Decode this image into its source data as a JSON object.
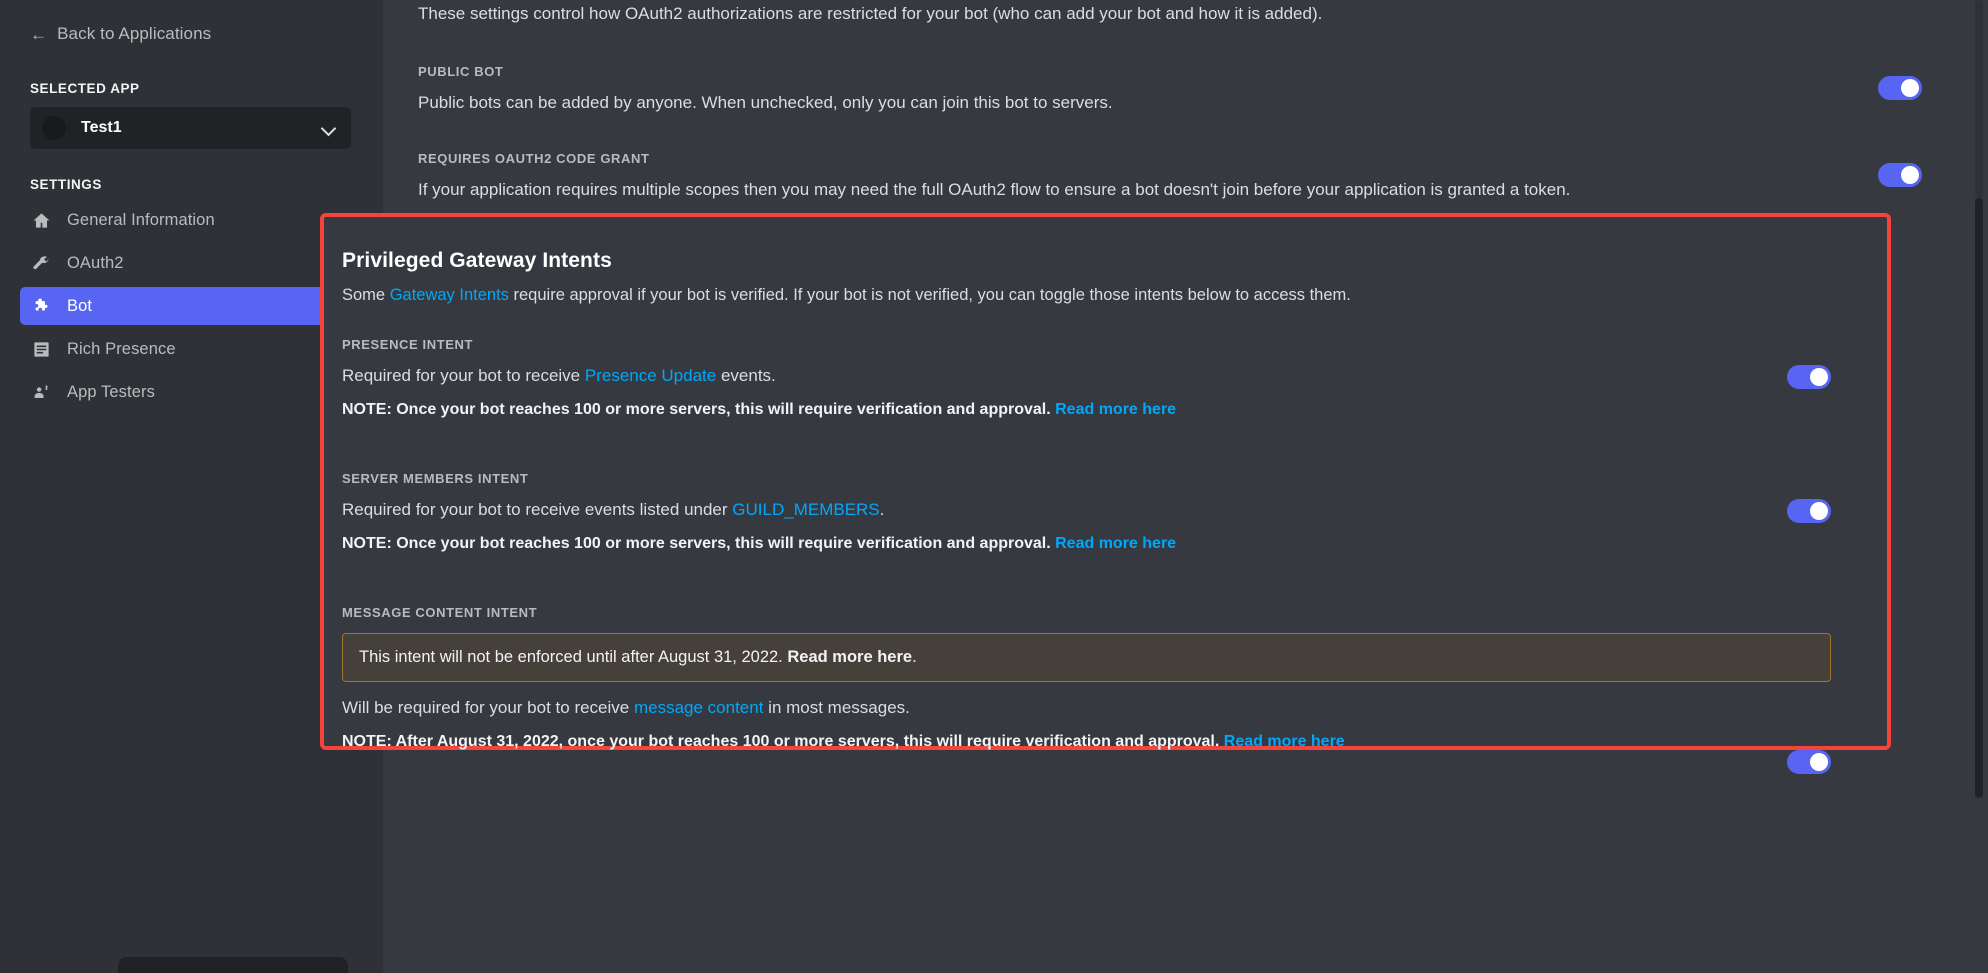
{
  "sidebar": {
    "back_label": "Back to Applications",
    "back_icon": "arrow-left-icon",
    "selected_app_label": "SELECTED APP",
    "selected_app_name": "Test1",
    "settings_label": "SETTINGS",
    "items": [
      {
        "label": "General Information",
        "icon": "home-icon",
        "active": false,
        "has_chevron": false
      },
      {
        "label": "OAuth2",
        "icon": "wrench-icon",
        "active": false,
        "has_chevron": true
      },
      {
        "label": "Bot",
        "icon": "puzzle-piece-icon",
        "active": true,
        "has_chevron": false
      },
      {
        "label": "Rich Presence",
        "icon": "list-card-icon",
        "active": false,
        "has_chevron": true
      },
      {
        "label": "App Testers",
        "icon": "person-raising-hand-icon",
        "active": false,
        "has_chevron": false
      }
    ]
  },
  "main": {
    "intro": "These settings control how OAuth2 authorizations are restricted for your bot (who can add your bot and how it is added).",
    "public_bot": {
      "label": "PUBLIC BOT",
      "description": "Public bots can be added by anyone. When unchecked, only you can join this bot to servers.",
      "toggle_on": true
    },
    "oauth2_code_grant": {
      "label": "REQUIRES OAUTH2 CODE GRANT",
      "description": "If your application requires multiple scopes then you may need the full OAuth2 flow to ensure a bot doesn't join before your application is granted a token.",
      "toggle_on": true
    },
    "intents": {
      "title": "Privileged Gateway Intents",
      "subtitle_before": "Some ",
      "subtitle_link": "Gateway Intents",
      "subtitle_after": " require approval if your bot is verified. If your bot is not verified, you can toggle those intents below to access them.",
      "presence": {
        "label": "PRESENCE INTENT",
        "desc_before": "Required for your bot to receive ",
        "desc_link": "Presence Update",
        "desc_after": " events.",
        "note_text": "NOTE: Once your bot reaches 100 or more servers, this will require verification and approval. ",
        "note_link": "Read more here",
        "toggle_on": true
      },
      "server_members": {
        "label": "SERVER MEMBERS INTENT",
        "desc_before": "Required for your bot to receive events listed under ",
        "desc_link": "GUILD_MEMBERS",
        "desc_after": ".",
        "note_text": "NOTE: Once your bot reaches 100 or more servers, this will require verification and approval. ",
        "note_link": "Read more here",
        "toggle_on": true
      },
      "message_content": {
        "label": "MESSAGE CONTENT INTENT",
        "banner_before": "This intent will not be enforced until after August 31, 2022. ",
        "banner_link": "Read more here",
        "banner_after": ".",
        "desc_before": "Will be required for your bot to receive ",
        "desc_link": "message content",
        "desc_after": " in most messages.",
        "note_text": "NOTE: After August 31, 2022, once your bot reaches 100 or more servers, this will require verification and approval. ",
        "note_link": "Read more here",
        "toggle_on": true
      }
    }
  },
  "colors": {
    "accent": "#5865f2",
    "link": "#00a8fc",
    "highlight_border": "#f5443c",
    "warning_border": "#a0762f",
    "sidebar_bg": "#2f3136",
    "main_bg": "#36393f"
  }
}
